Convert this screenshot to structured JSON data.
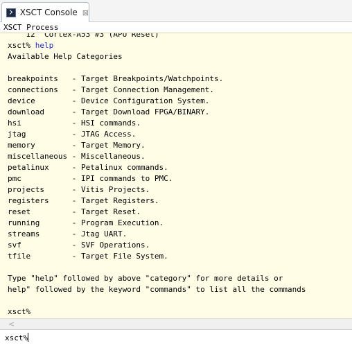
{
  "tab": {
    "title": "XSCT Console",
    "close": "⊠"
  },
  "process_label": "XSCT Process",
  "console": {
    "lines": [
      {
        "text": "    12  Cortex-A53 #3 (APU Reset)"
      },
      {
        "prompt": "xsct% ",
        "command": "help"
      },
      {
        "text": "Available Help Categories"
      },
      {
        "text": ""
      },
      {
        "text": "breakpoints   - Target Breakpoints/Watchpoints."
      },
      {
        "text": "connections   - Target Connection Management."
      },
      {
        "text": "device        - Device Configuration System."
      },
      {
        "text": "download      - Target Download FPGA/BINARY."
      },
      {
        "text": "hsi           - HSI commands."
      },
      {
        "text": "jtag          - JTAG Access."
      },
      {
        "text": "memory        - Target Memory."
      },
      {
        "text": "miscellaneous - Miscellaneous."
      },
      {
        "text": "petalinux     - Petalinux commands."
      },
      {
        "text": "pmc           - IPI commands to PMC."
      },
      {
        "text": "projects      - Vitis Projects."
      },
      {
        "text": "registers     - Target Registers."
      },
      {
        "text": "reset         - Target Reset."
      },
      {
        "text": "running       - Program Execution."
      },
      {
        "text": "streams       - Jtag UART."
      },
      {
        "text": "svf           - SVF Operations."
      },
      {
        "text": "tfile         - Target File System."
      },
      {
        "text": ""
      },
      {
        "text": "Type \"help\" followed by above \"category\" for more details or"
      },
      {
        "text": "help\" followed by the keyword \"commands\" to list all the commands"
      },
      {
        "text": ""
      },
      {
        "text": "xsct%"
      }
    ]
  },
  "scrollbar": {
    "left_arrow": "<"
  },
  "input": {
    "prompt": "xsct%"
  }
}
